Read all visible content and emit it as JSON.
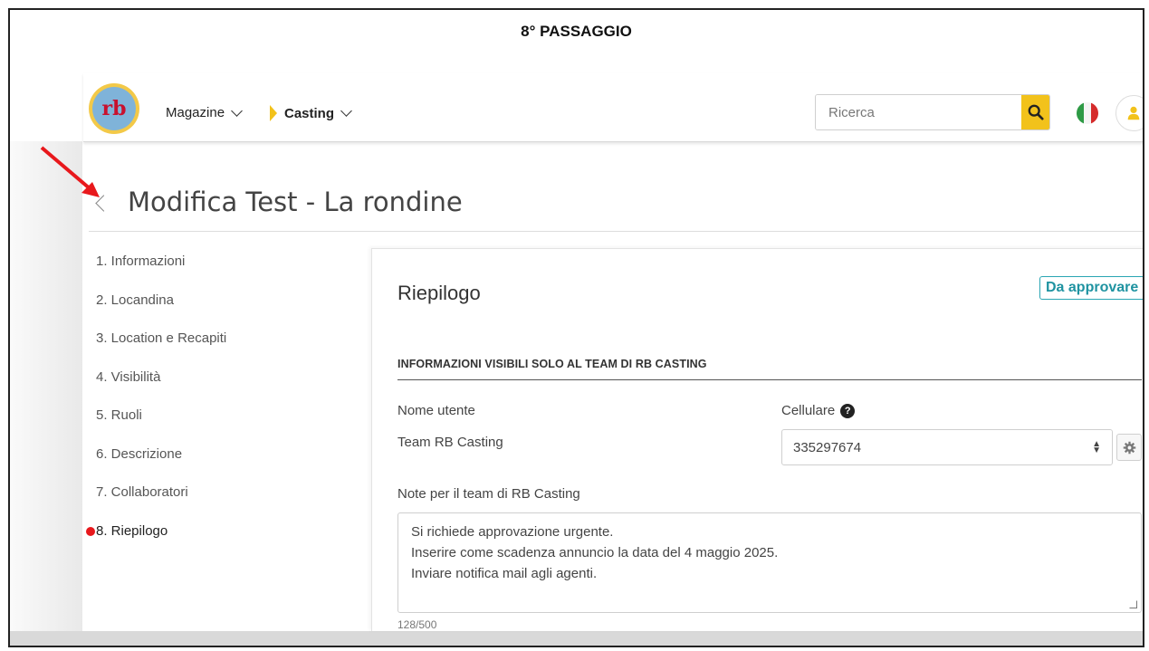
{
  "step_title": "8° PASSAGGIO",
  "header": {
    "nav": [
      {
        "label": "Magazine"
      },
      {
        "label": "Casting"
      }
    ],
    "search": {
      "placeholder": "Ricerca"
    },
    "colors": {
      "accent": "#f2c21b",
      "badge": "#2aa6b3"
    }
  },
  "page": {
    "title": "Modifica Test - La rondine"
  },
  "steps": [
    {
      "label": "1. Informazioni"
    },
    {
      "label": "2. Locandina"
    },
    {
      "label": "3. Location e Recapiti"
    },
    {
      "label": "4. Visibilità"
    },
    {
      "label": "5. Ruoli"
    },
    {
      "label": "6. Descrizione"
    },
    {
      "label": "7. Collaboratori"
    },
    {
      "label": "8. Riepilogo"
    }
  ],
  "panel": {
    "title": "Riepilogo",
    "status_badge": "Da approvare",
    "section_title": "INFORMAZIONI VISIBILI SOLO AL TEAM DI RB CASTING",
    "username_label": "Nome utente",
    "username_value": "Team RB Casting",
    "phone_label": "Cellulare",
    "phone_help": "?",
    "phone_value": "335297674",
    "notes_label": "Note per il team di RB Casting",
    "notes_lines": [
      "Si richiede approvazione urgente.",
      "Inserire come scadenza annuncio la data del 4 maggio 2025.",
      "Inviare notifica mail agli agenti."
    ],
    "notes_counter": "128/500"
  }
}
